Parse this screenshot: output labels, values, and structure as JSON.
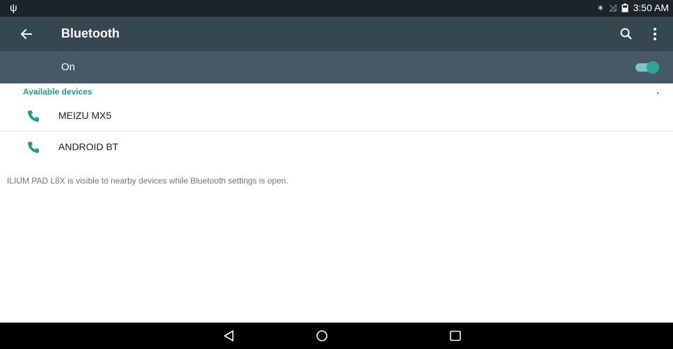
{
  "status_bar": {
    "time": "3:50 AM",
    "icons": [
      "usb-icon",
      "bluetooth-icon",
      "no-signal-icon",
      "battery-icon"
    ]
  },
  "app_bar": {
    "title": "Bluetooth",
    "icons": [
      "back-arrow-icon",
      "search-icon",
      "more-vert-icon"
    ]
  },
  "master_toggle": {
    "label": "On",
    "checked": true,
    "track_color": "#7fc6bd",
    "thumb_color": "#2aa598"
  },
  "section": {
    "header": "Available devices"
  },
  "devices": [
    {
      "name": "MEIZU MX5",
      "icon": "phone-icon"
    },
    {
      "name": "ANDROID BT",
      "icon": "phone-icon"
    }
  ],
  "footer": {
    "text": "ILIUM PAD L8X is visible to nearby devices while Bluetooth settings is open."
  },
  "colors": {
    "status_bar": "#1b2429",
    "app_bar": "#36474f",
    "toggle_row": "#455a64",
    "accent": "#1e9d8f"
  },
  "nav_bar": {
    "buttons": [
      "back-triangle-icon",
      "home-circle-icon",
      "recents-square-icon"
    ]
  }
}
